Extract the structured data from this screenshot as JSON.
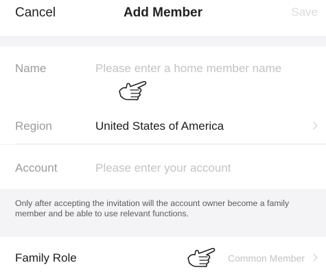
{
  "nav": {
    "cancel_label": "Cancel",
    "title": "Add Member",
    "save_label": "Save"
  },
  "form": {
    "name": {
      "label": "Name",
      "placeholder": "Please enter a home member name"
    },
    "region": {
      "label": "Region",
      "value": "United States of America"
    },
    "account": {
      "label": "Account",
      "placeholder": "Please enter your account"
    },
    "note": "Only after accepting the invitation will the account owner become a family member and be able to use relevant functions.",
    "family_role": {
      "label": "Family Role",
      "value": "Common Member"
    }
  },
  "icons": {
    "pointer": "pointing-hand-icon",
    "chevron": "chevron-right-icon"
  },
  "colors": {
    "background": "#f4f4f6",
    "surface": "#ffffff",
    "placeholder": "#c3c3c3",
    "label": "#9b9b9b",
    "text": "#1c1c1c",
    "save_disabled": "#dcdcdc"
  }
}
